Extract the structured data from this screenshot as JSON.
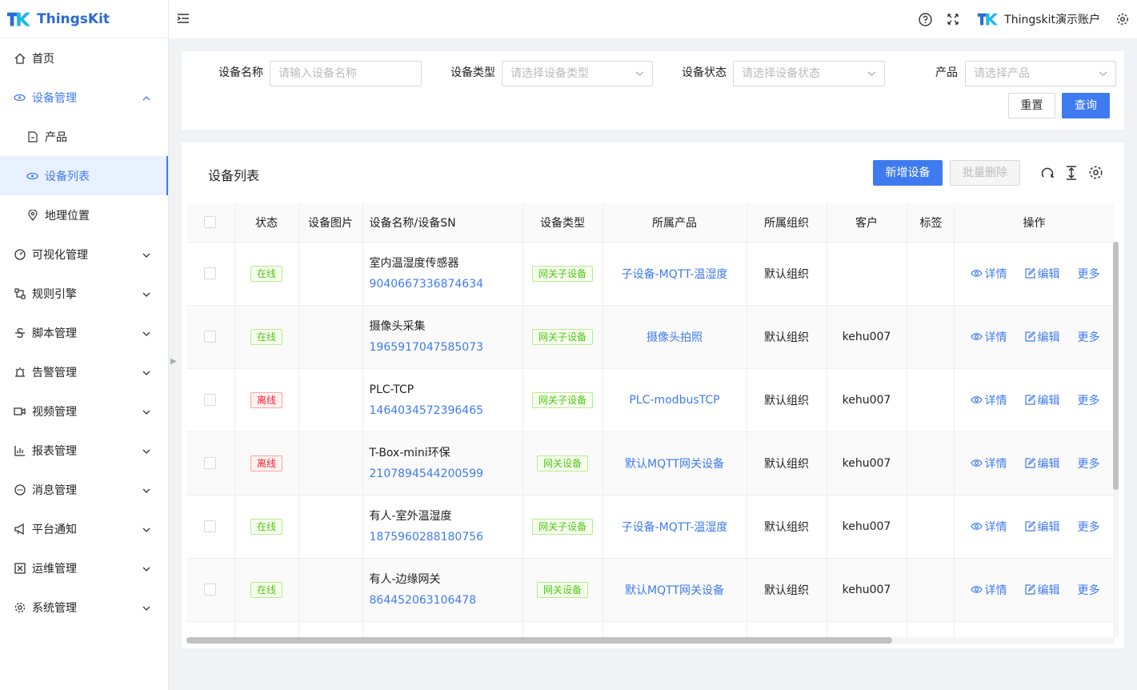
{
  "app": {
    "name": "ThingsKit"
  },
  "header": {
    "account": "Thingskit演示账户"
  },
  "sidebar": {
    "items": [
      {
        "label": "首页",
        "icon": "home-icon"
      },
      {
        "label": "设备管理",
        "icon": "device-icon"
      },
      {
        "label": "产品",
        "icon": "product-icon"
      },
      {
        "label": "设备列表",
        "icon": "device-list-icon"
      },
      {
        "label": "地理位置",
        "icon": "location-icon"
      },
      {
        "label": "可视化管理",
        "icon": "dashboard-icon"
      },
      {
        "label": "规则引擎",
        "icon": "rule-icon"
      },
      {
        "label": "脚本管理",
        "icon": "script-icon"
      },
      {
        "label": "告警管理",
        "icon": "alarm-icon"
      },
      {
        "label": "视频管理",
        "icon": "video-icon"
      },
      {
        "label": "报表管理",
        "icon": "report-icon"
      },
      {
        "label": "消息管理",
        "icon": "message-icon"
      },
      {
        "label": "平台通知",
        "icon": "notice-icon"
      },
      {
        "label": "运维管理",
        "icon": "ops-icon"
      },
      {
        "label": "系统管理",
        "icon": "system-icon"
      }
    ]
  },
  "filter": {
    "name_label": "设备名称",
    "name_placeholder": "请输入设备名称",
    "type_label": "设备类型",
    "type_placeholder": "请选择设备类型",
    "status_label": "设备状态",
    "status_placeholder": "请选择设备状态",
    "product_label": "产品",
    "product_placeholder": "请选择产品",
    "reset": "重置",
    "search": "查询"
  },
  "table": {
    "title": "设备列表",
    "add_button": "新增设备",
    "batch_delete": "批量删除",
    "columns": [
      "状态",
      "设备图片",
      "设备名称/设备SN",
      "设备类型",
      "所属产品",
      "所属组织",
      "客户",
      "标签",
      "操作"
    ],
    "ops": {
      "detail": "详情",
      "edit": "编辑",
      "more": "更多"
    },
    "rows": [
      {
        "status": "在线",
        "name": "室内温湿度传感器",
        "sn": "9040667336874634",
        "type": "网关子设备",
        "product": "子设备-MQTT-温湿度",
        "org": "默认组织",
        "customer": ""
      },
      {
        "status": "在线",
        "name": "摄像头采集",
        "sn": "1965917047585073",
        "type": "网关子设备",
        "product": "摄像头拍照",
        "org": "默认组织",
        "customer": "kehu007"
      },
      {
        "status": "离线",
        "name": "PLC-TCP",
        "sn": "1464034572396465",
        "type": "网关子设备",
        "product": "PLC-modbusTCP",
        "org": "默认组织",
        "customer": "kehu007"
      },
      {
        "status": "离线",
        "name": "T-Box-mini环保",
        "sn": "2107894544200599",
        "type": "网关设备",
        "product": "默认MQTT网关设备",
        "org": "默认组织",
        "customer": "kehu007"
      },
      {
        "status": "在线",
        "name": "有人-室外温湿度",
        "sn": "1875960288180756",
        "type": "网关子设备",
        "product": "子设备-MQTT-温湿度",
        "org": "默认组织",
        "customer": "kehu007"
      },
      {
        "status": "在线",
        "name": "有人-边缘网关",
        "sn": "864452063106478",
        "type": "网关设备",
        "product": "默认MQTT网关设备",
        "org": "默认组织",
        "customer": "kehu007"
      }
    ]
  }
}
